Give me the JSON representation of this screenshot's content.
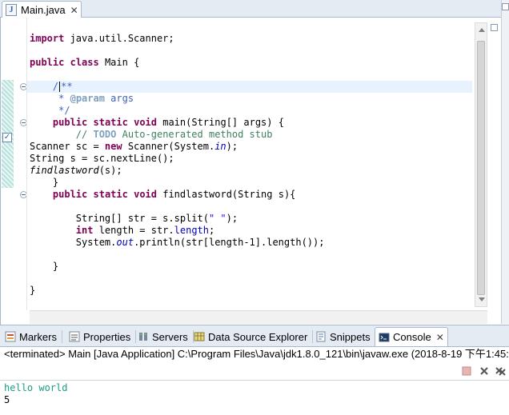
{
  "editor": {
    "tab_title": "Main.java",
    "tab_icon": "java-file-icon",
    "lines": {
      "l1_kw": "import",
      "l1_rest": " java.util.Scanner;",
      "l2_kw1": "public",
      "l2_kw2": "class",
      "l2_rest": " Main {",
      "l3a": "/",
      "l3b": "**",
      "l4_star": " * ",
      "l4_tag": "@param",
      "l4_rest": " args",
      "l5": " */",
      "l6_kw1": "public",
      "l6_kw2": "static",
      "l6_kw3": "void",
      "l6_rest": " main(String[] args) {",
      "l7_prefix": "// ",
      "l7_todo": "TODO",
      "l7_rest": " Auto-generated method stub",
      "l8_a": "Scanner sc = ",
      "l8_kw": "new",
      "l8_b": " Scanner(System.",
      "l8_field": "in",
      "l8_c": ");",
      "l9": "String s = sc.nextLine();",
      "l10_a": "findlastword",
      "l10_b": "(s);",
      "l11": "}",
      "l12_kw1": "public",
      "l12_kw2": "static",
      "l12_kw3": "void",
      "l12_rest": " findlastword(String s){",
      "l13_a": "String[] str = s.split(",
      "l13_str": "\" \"",
      "l13_b": ");",
      "l14_kw": "int",
      "l14_a": " length = str.",
      "l14_field": "length",
      "l14_b": ";",
      "l15_a": "System.",
      "l15_field": "out",
      "l15_b": ".println(str[length-1].length());",
      "l16": "}",
      "l17": "}"
    }
  },
  "views": {
    "tabs": [
      {
        "label": "Markers",
        "icon": "markers-icon"
      },
      {
        "label": "Properties",
        "icon": "properties-icon"
      },
      {
        "label": "Servers",
        "icon": "servers-icon"
      },
      {
        "label": "Data Source Explorer",
        "icon": "data-source-icon"
      },
      {
        "label": "Snippets",
        "icon": "snippets-icon"
      },
      {
        "label": "Console",
        "icon": "console-icon",
        "active": true
      }
    ],
    "close_glyph": "✕"
  },
  "console": {
    "header": "<terminated> Main [Java Application] C:\\Program Files\\Java\\jdk1.8.0_121\\bin\\javaw.exe (2018-8-19 下午1:45:",
    "output_line1": "hello world",
    "output_line2": "5"
  },
  "colors": {
    "keyword": "#7f0055",
    "comment": "#3f7f5f",
    "javadoc": "#3f5fbf",
    "string": "#2a00ff",
    "field": "#0000c0",
    "console_input": "#1c9c84"
  }
}
